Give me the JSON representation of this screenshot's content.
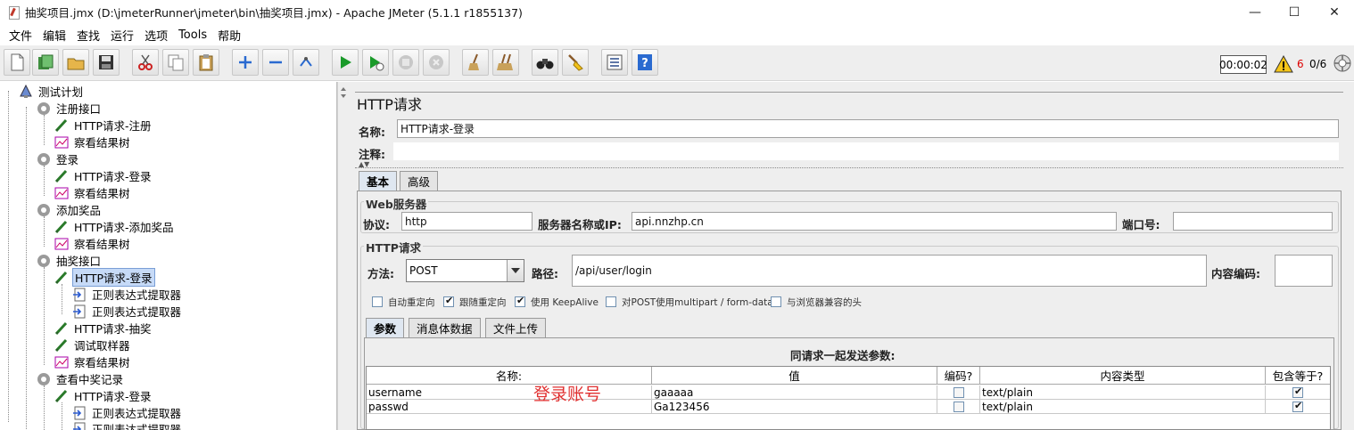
{
  "window": {
    "title": "抽奖项目.jmx (D:\\jmeterRunner\\jmeter\\bin\\抽奖项目.jmx) - Apache JMeter (5.1.1 r1855137)",
    "minimize": "—",
    "maximize": "☐",
    "close": "✕"
  },
  "menu": [
    "文件",
    "编辑",
    "查找",
    "运行",
    "选项",
    "Tools",
    "帮助"
  ],
  "toolbar": {
    "buttons": [
      "new-icon",
      "templates-icon",
      "open-icon",
      "save-icon",
      "cut-icon",
      "copy-icon",
      "paste-icon",
      "expand-icon",
      "collapse-icon",
      "toggle-icon",
      "start-icon",
      "start-no-pause-icon",
      "stop-icon",
      "shutdown-icon",
      "clear-icon",
      "clear-all-icon",
      "search-icon",
      "reset-search-icon",
      "function-helper-icon",
      "help-icon"
    ],
    "timer": "00:00:02",
    "warnings": "6",
    "threads": "0/6"
  },
  "tree": [
    {
      "label": "测试计划",
      "icon": "test-plan-icon"
    },
    {
      "label": "注册接口",
      "icon": "thread-group-icon"
    },
    {
      "label": "HTTP请求-注册",
      "icon": "sampler-icon"
    },
    {
      "label": "察看结果树",
      "icon": "listener-icon"
    },
    {
      "label": "登录",
      "icon": "thread-group-icon"
    },
    {
      "label": "HTTP请求-登录",
      "icon": "sampler-icon"
    },
    {
      "label": "察看结果树",
      "icon": "listener-icon"
    },
    {
      "label": "添加奖品",
      "icon": "thread-group-icon"
    },
    {
      "label": "HTTP请求-添加奖品",
      "icon": "sampler-icon"
    },
    {
      "label": "察看结果树",
      "icon": "listener-icon"
    },
    {
      "label": "抽奖接口",
      "icon": "thread-group-icon"
    },
    {
      "label": "HTTP请求-登录",
      "icon": "sampler-icon"
    },
    {
      "label": "正则表达式提取器",
      "icon": "extractor-icon"
    },
    {
      "label": "正则表达式提取器",
      "icon": "extractor-icon"
    },
    {
      "label": "HTTP请求-抽奖",
      "icon": "sampler-icon"
    },
    {
      "label": "调试取样器",
      "icon": "sampler-icon"
    },
    {
      "label": "察看结果树",
      "icon": "listener-icon"
    },
    {
      "label": "查看中奖记录",
      "icon": "thread-group-icon"
    },
    {
      "label": "HTTP请求-登录",
      "icon": "sampler-icon"
    },
    {
      "label": "正则表达式提取器",
      "icon": "extractor-icon"
    },
    {
      "label": "正则表达式提取器",
      "icon": "extractor-icon"
    }
  ],
  "panel": {
    "title": "HTTP请求",
    "name_label": "名称:",
    "name_value": "HTTP请求-登录",
    "comment_label": "注释:",
    "comment_value": "",
    "tabs": [
      "基本",
      "高级"
    ],
    "web_server": {
      "title": "Web服务器",
      "protocol_label": "协议:",
      "protocol_value": "http",
      "server_label": "服务器名称或IP:",
      "server_value": "api.nnzhp.cn",
      "port_label": "端口号:",
      "port_value": ""
    },
    "http_request": {
      "title": "HTTP请求",
      "method_label": "方法:",
      "method_value": "POST",
      "path_label": "路径:",
      "path_value": "/api/user/login",
      "encoding_label": "内容编码:",
      "encoding_value": ""
    },
    "options": [
      {
        "label": "自动重定向",
        "checked": false
      },
      {
        "label": "跟随重定向",
        "checked": true
      },
      {
        "label": "使用 KeepAlive",
        "checked": true
      },
      {
        "label": "对POST使用multipart / form-data",
        "checked": false
      },
      {
        "label": "与浏览器兼容的头",
        "checked": false
      }
    ],
    "param_tabs": [
      "参数",
      "消息体数据",
      "文件上传"
    ],
    "table": {
      "caption": "同请求一起发送参数:",
      "headers": [
        "名称:",
        "值",
        "编码?",
        "内容类型",
        "包含等于?"
      ],
      "rows": [
        {
          "name": "username",
          "value": "gaaaaa",
          "encode": false,
          "ctype": "text/plain",
          "include_eq": true
        },
        {
          "name": "passwd",
          "value": "Ga123456",
          "encode": false,
          "ctype": "text/plain",
          "include_eq": true
        }
      ]
    },
    "annotation": "登录账号"
  }
}
